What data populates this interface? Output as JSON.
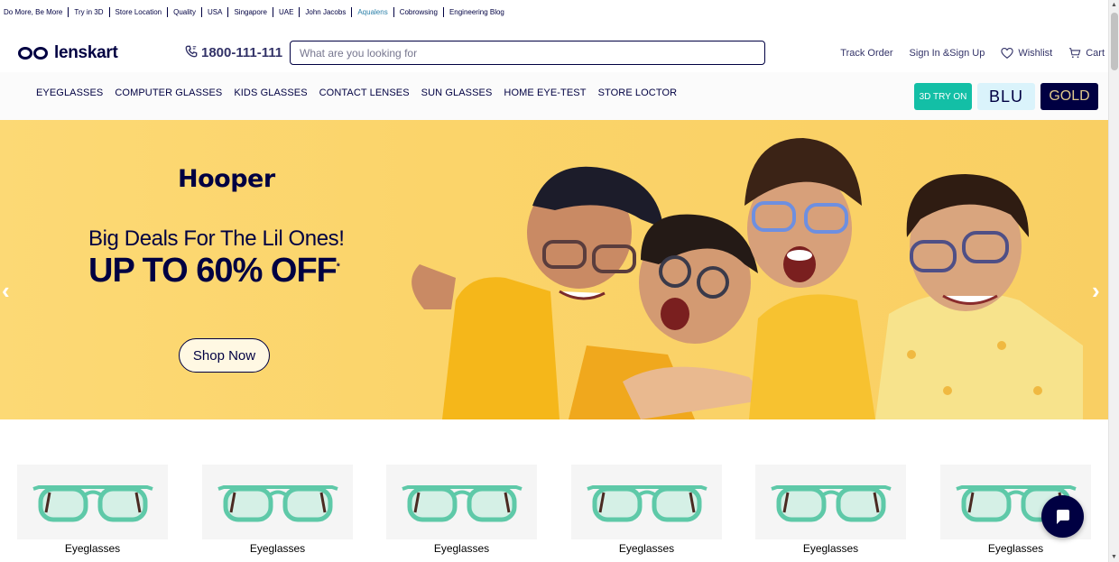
{
  "topbar": {
    "links": [
      "Do More, Be More",
      "Try in 3D",
      "Store Location",
      "Quality",
      "USA",
      "Singapore",
      "UAE",
      "John Jacobs",
      "Aqualens",
      "Cobrowsing",
      "Engineering Blog"
    ]
  },
  "header": {
    "logo_text": "lenskart",
    "phone": "1800-111-111",
    "search_placeholder": "What are you looking for",
    "track_order": "Track Order",
    "sign_in": "Sign In &Sign Up",
    "wishlist": "Wishlist",
    "cart": "Cart"
  },
  "nav": {
    "items": [
      "EYEGLASSES",
      "COMPUTER GLASSES",
      "KIDS GLASSES",
      "CONTACT LENSES",
      "SUN GLASSES",
      "HOME EYE-TEST",
      "STORE LOCTOR"
    ],
    "btn_3d": "3D TRY ON",
    "btn_blu": "BLU",
    "btn_gold": "GOLD"
  },
  "banner": {
    "brand": "Hooper",
    "subline": "Big Deals For The Lil Ones!",
    "headline": "UP TO 60% OFF",
    "headline_mark": "*",
    "cta": "Shop Now",
    "prev": "‹",
    "next": "›"
  },
  "categories": [
    {
      "label": "Eyeglasses"
    },
    {
      "label": "Eyeglasses"
    },
    {
      "label": "Eyeglasses"
    },
    {
      "label": "Eyeglasses"
    },
    {
      "label": "Eyeglasses"
    },
    {
      "label": "Eyeglasses"
    }
  ],
  "colors": {
    "brand_navy": "#000042",
    "teal": "#13bfa6",
    "banner_yellow": "#fbd46a",
    "frame_green": "#5ec9a8"
  }
}
